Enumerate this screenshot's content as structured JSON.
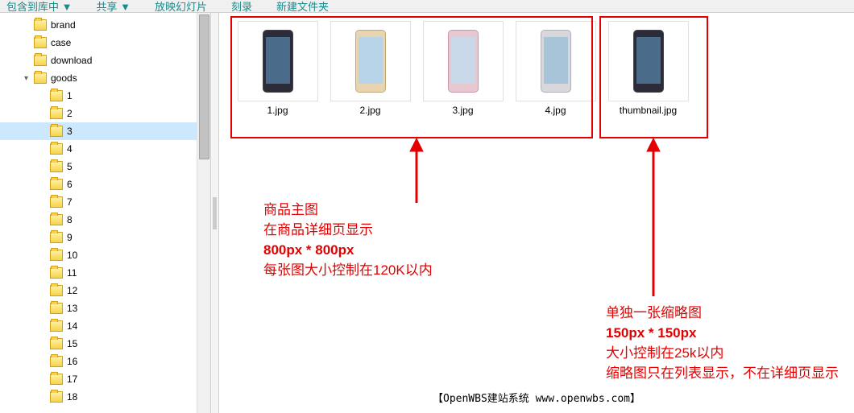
{
  "toolbar": {
    "items": [
      "包含到库中 ▼",
      "共享 ▼",
      "放映幻灯片",
      "刻录",
      "新建文件夹"
    ]
  },
  "tree": [
    {
      "label": "brand",
      "indent": 1,
      "arrow": ""
    },
    {
      "label": "case",
      "indent": 1,
      "arrow": ""
    },
    {
      "label": "download",
      "indent": 1,
      "arrow": ""
    },
    {
      "label": "goods",
      "indent": 1,
      "arrow": "▾"
    },
    {
      "label": "1",
      "indent": 2,
      "arrow": ""
    },
    {
      "label": "2",
      "indent": 2,
      "arrow": ""
    },
    {
      "label": "3",
      "indent": 2,
      "arrow": "",
      "selected": true
    },
    {
      "label": "4",
      "indent": 2,
      "arrow": ""
    },
    {
      "label": "5",
      "indent": 2,
      "arrow": ""
    },
    {
      "label": "6",
      "indent": 2,
      "arrow": ""
    },
    {
      "label": "7",
      "indent": 2,
      "arrow": ""
    },
    {
      "label": "8",
      "indent": 2,
      "arrow": ""
    },
    {
      "label": "9",
      "indent": 2,
      "arrow": ""
    },
    {
      "label": "10",
      "indent": 2,
      "arrow": ""
    },
    {
      "label": "11",
      "indent": 2,
      "arrow": ""
    },
    {
      "label": "12",
      "indent": 2,
      "arrow": ""
    },
    {
      "label": "13",
      "indent": 2,
      "arrow": ""
    },
    {
      "label": "14",
      "indent": 2,
      "arrow": ""
    },
    {
      "label": "15",
      "indent": 2,
      "arrow": ""
    },
    {
      "label": "16",
      "indent": 2,
      "arrow": ""
    },
    {
      "label": "17",
      "indent": 2,
      "arrow": ""
    },
    {
      "label": "18",
      "indent": 2,
      "arrow": ""
    }
  ],
  "thumbs": [
    {
      "name": "1.jpg",
      "phone": "dark"
    },
    {
      "name": "2.jpg",
      "phone": "gold"
    },
    {
      "name": "3.jpg",
      "phone": "pink"
    },
    {
      "name": "4.jpg",
      "phone": "silver"
    },
    {
      "name": "thumbnail.jpg",
      "phone": "dark"
    }
  ],
  "anno1": {
    "line1": "商品主图",
    "line2": "在商品详细页显示",
    "line3": "800px * 800px",
    "line4": "每张图大小控制在120K以内"
  },
  "anno2": {
    "line1": "单独一张缩略图",
    "line2": "150px * 150px",
    "line3": "大小控制在25k以内",
    "line4": "缩略图只在列表显示，不在详细页显示"
  },
  "footer": "【OpenWBS建站系统 www.openwbs.com】"
}
